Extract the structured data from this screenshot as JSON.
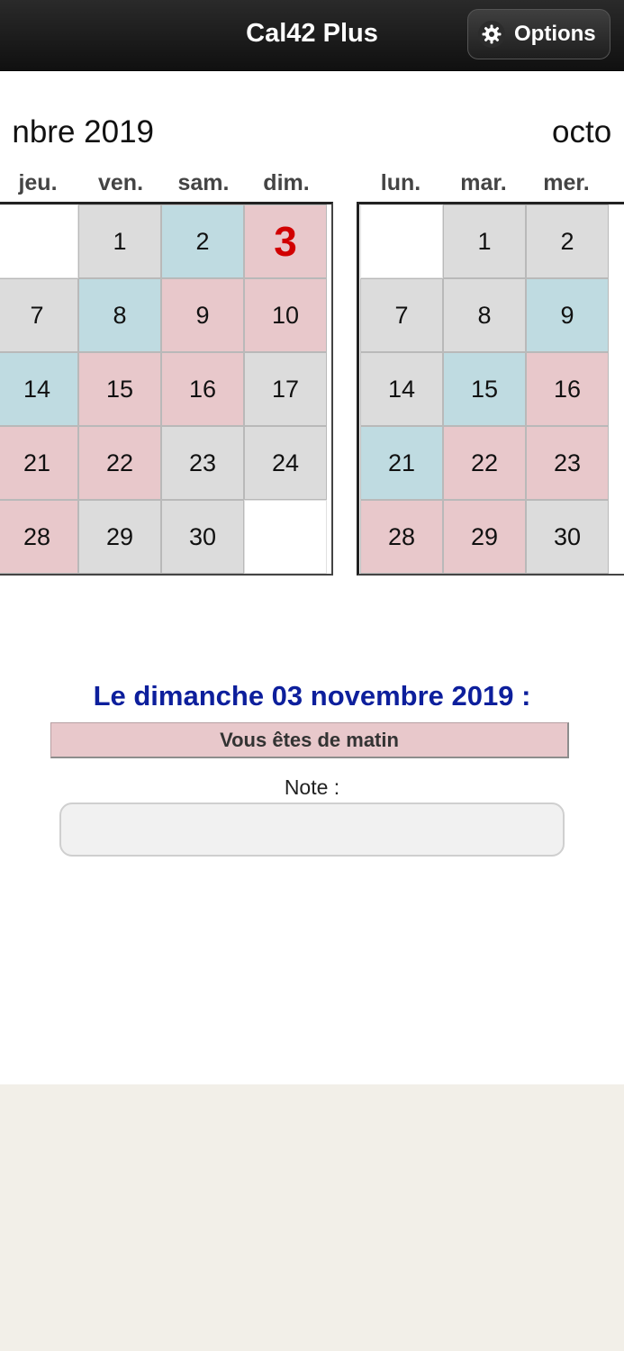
{
  "header": {
    "title": "Cal42 Plus",
    "options_label": "Options",
    "options_icon": "gear-icon"
  },
  "left_month": {
    "title": "nbre 2019",
    "weekdays": [
      "jeu.",
      "ven.",
      "sam.",
      "dim."
    ],
    "cells": [
      {
        "day": "",
        "color": "white"
      },
      {
        "day": "1",
        "color": "gray"
      },
      {
        "day": "2",
        "color": "blue"
      },
      {
        "day": "3",
        "color": "pink",
        "today": true
      },
      {
        "day": "7",
        "color": "gray"
      },
      {
        "day": "8",
        "color": "blue"
      },
      {
        "day": "9",
        "color": "pink"
      },
      {
        "day": "10",
        "color": "pink"
      },
      {
        "day": "14",
        "color": "blue"
      },
      {
        "day": "15",
        "color": "pink"
      },
      {
        "day": "16",
        "color": "pink"
      },
      {
        "day": "17",
        "color": "gray"
      },
      {
        "day": "21",
        "color": "pink"
      },
      {
        "day": "22",
        "color": "pink"
      },
      {
        "day": "23",
        "color": "gray"
      },
      {
        "day": "24",
        "color": "gray"
      },
      {
        "day": "28",
        "color": "pink"
      },
      {
        "day": "29",
        "color": "gray"
      },
      {
        "day": "30",
        "color": "gray"
      },
      {
        "day": "",
        "color": "white"
      }
    ]
  },
  "right_month": {
    "title": "octo",
    "weekdays": [
      "lun.",
      "mar.",
      "mer."
    ],
    "cells": [
      {
        "day": "",
        "color": "white"
      },
      {
        "day": "1",
        "color": "gray"
      },
      {
        "day": "2",
        "color": "gray"
      },
      {
        "day": "7",
        "color": "gray"
      },
      {
        "day": "8",
        "color": "gray"
      },
      {
        "day": "9",
        "color": "blue"
      },
      {
        "day": "14",
        "color": "gray"
      },
      {
        "day": "15",
        "color": "blue"
      },
      {
        "day": "16",
        "color": "pink"
      },
      {
        "day": "21",
        "color": "blue"
      },
      {
        "day": "22",
        "color": "pink"
      },
      {
        "day": "23",
        "color": "pink"
      },
      {
        "day": "28",
        "color": "pink"
      },
      {
        "day": "29",
        "color": "pink"
      },
      {
        "day": "30",
        "color": "gray"
      }
    ]
  },
  "detail": {
    "date_heading": "Le dimanche 03 novembre 2019 :",
    "shift_text": "Vous êtes de matin",
    "note_label": "Note :",
    "note_value": ""
  },
  "colors": {
    "gray": "#dcdcdc",
    "blue": "#bfdbe1",
    "pink": "#e8c8cb",
    "today_text": "#d10000",
    "heading_blue": "#0d1f9c"
  }
}
